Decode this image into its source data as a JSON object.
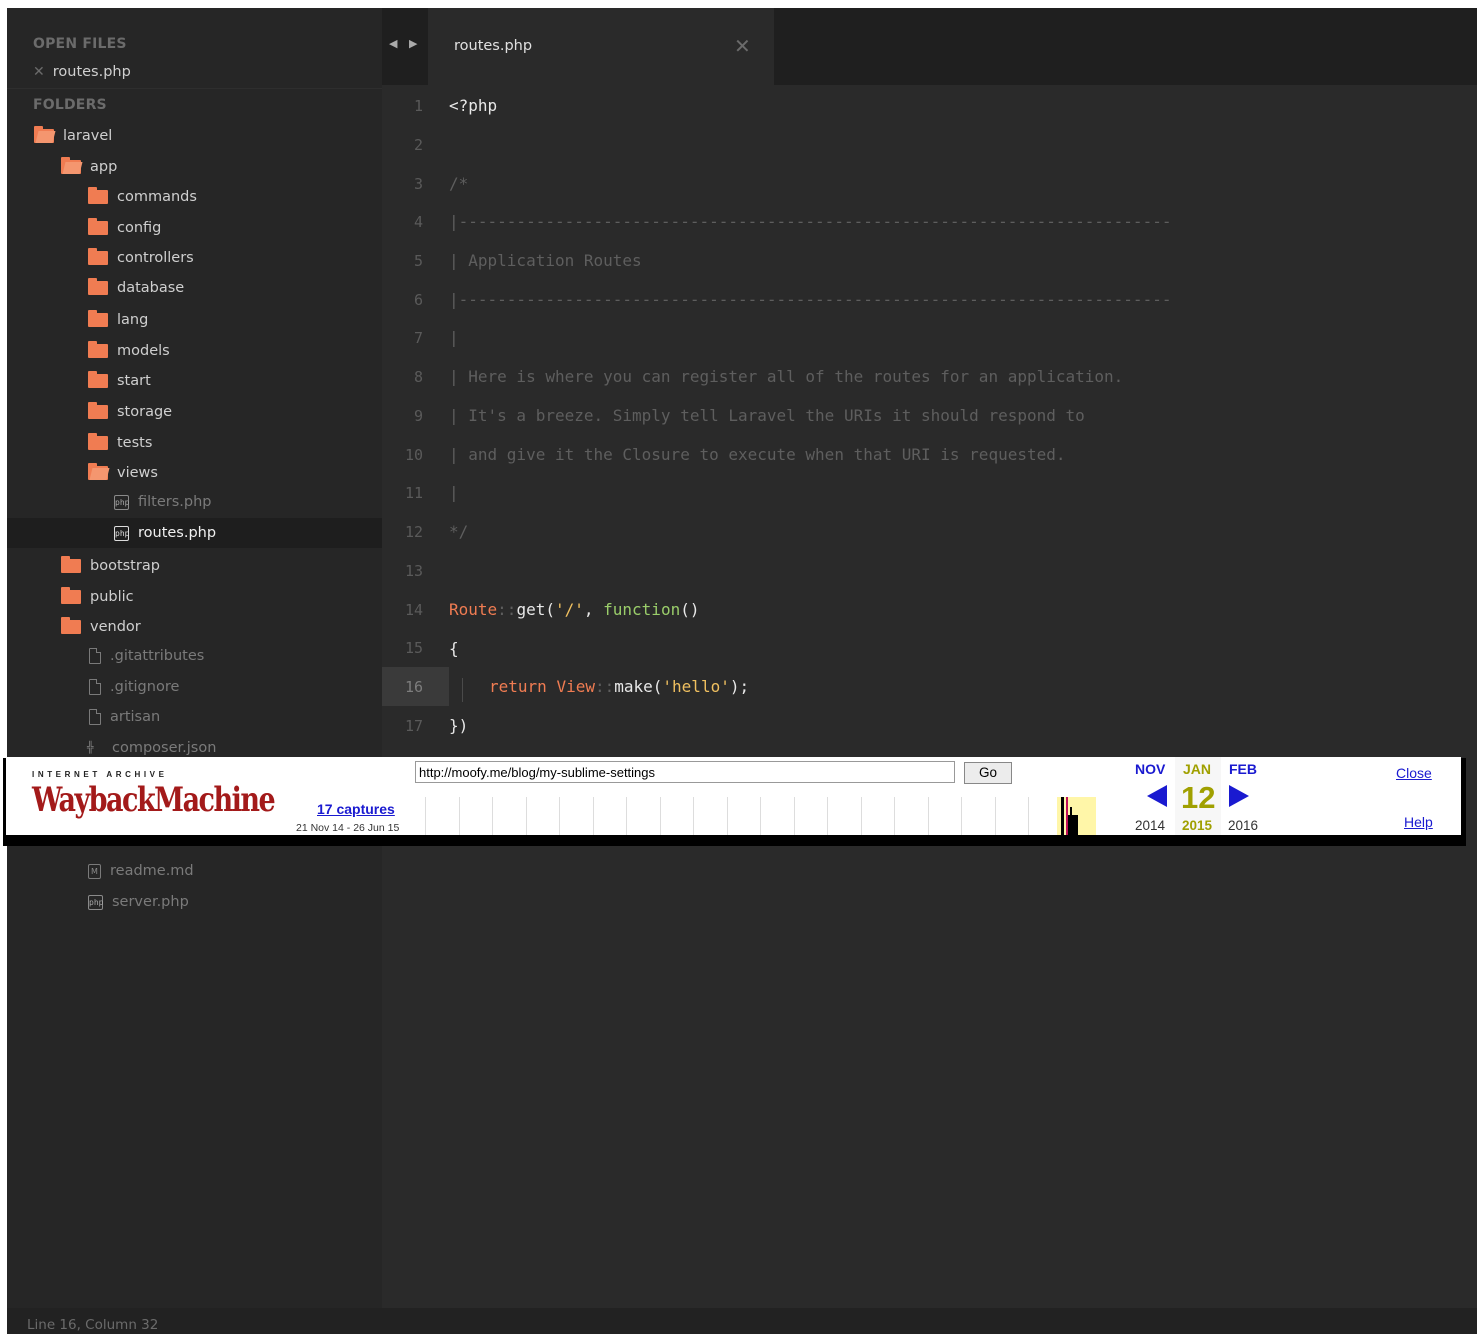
{
  "sidebar": {
    "open_files_header": "OPEN FILES",
    "open_files": [
      {
        "label": "routes.php"
      }
    ],
    "folders_header": "FOLDERS",
    "tree": [
      {
        "label": "laravel",
        "icon": "folder-open-icon"
      },
      {
        "label": "app",
        "icon": "folder-open-icon"
      },
      {
        "label": "commands",
        "icon": "folder-icon"
      },
      {
        "label": "config",
        "icon": "folder-icon"
      },
      {
        "label": "controllers",
        "icon": "folder-icon"
      },
      {
        "label": "database",
        "icon": "folder-icon"
      },
      {
        "label": "lang",
        "icon": "folder-icon"
      },
      {
        "label": "models",
        "icon": "folder-icon"
      },
      {
        "label": "start",
        "icon": "folder-icon"
      },
      {
        "label": "storage",
        "icon": "folder-icon"
      },
      {
        "label": "tests",
        "icon": "folder-icon"
      },
      {
        "label": "views",
        "icon": "folder-open-icon"
      },
      {
        "label": "filters.php",
        "icon": "php-file-icon"
      },
      {
        "label": "routes.php",
        "icon": "php-file-icon"
      },
      {
        "label": "bootstrap",
        "icon": "folder-icon"
      },
      {
        "label": "public",
        "icon": "folder-icon"
      },
      {
        "label": "vendor",
        "icon": "folder-icon"
      },
      {
        "label": ".gitattributes",
        "icon": "file-icon"
      },
      {
        "label": ".gitignore",
        "icon": "file-icon"
      },
      {
        "label": "artisan",
        "icon": "file-icon"
      },
      {
        "label": "composer.json",
        "icon": "json-file-icon"
      },
      {
        "label": "readme.md",
        "icon": "markdown-file-icon"
      },
      {
        "label": "server.php",
        "icon": "php-file-icon"
      }
    ]
  },
  "tab": {
    "label": "routes.php",
    "close": "✕",
    "nav": "◀ ▶"
  },
  "editor": {
    "line_numbers": [
      "1",
      "2",
      "3",
      "4",
      "5",
      "6",
      "7",
      "8",
      "9",
      "10",
      "11",
      "12",
      "13",
      "14",
      "15",
      "16",
      "17"
    ],
    "comment_lines": [
      "/*",
      "|--------------------------------------------------------------------------",
      "| Application Routes",
      "|--------------------------------------------------------------------------",
      "|",
      "| Here is where you can register all of the routes for an application.",
      "| It's a breeze. Simply tell Laravel the URIs it should respond to",
      "| and give it the Closure to execute when that URI is requested.",
      "|",
      "*/"
    ],
    "line1": "<?php",
    "line14": {
      "cls": "Route",
      "sep": "::",
      "method": "get(",
      "str": "'/'",
      "comma": ", ",
      "kw": "function",
      "end": "()"
    },
    "line15": "{",
    "line16": {
      "kw": "return",
      "cls": "View",
      "sep": "::",
      "method": "make(",
      "str": "'hello'",
      "end": ");"
    },
    "line17": "})"
  },
  "status": {
    "text": "Line 16, Column 32"
  },
  "wayback": {
    "brand_top": "INTERNET ARCHIVE",
    "brand_logo": "WaybackMachine",
    "url": "http://moofy.me/blog/my-sublime-settings",
    "go": "Go",
    "captures": "17 captures",
    "range": "21 Nov 14 - 26 Jun 15",
    "months": {
      "prev": "NOV",
      "cur": "JAN",
      "next": "FEB"
    },
    "day": "12",
    "years": {
      "prev": "2014",
      "cur": "2015",
      "next": "2016"
    },
    "close": "Close",
    "help": "Help"
  },
  "colors": {
    "accent": "#f07c52",
    "string": "#f0c060",
    "keyword": "#9acd6a",
    "link": "#1a1ad0"
  }
}
